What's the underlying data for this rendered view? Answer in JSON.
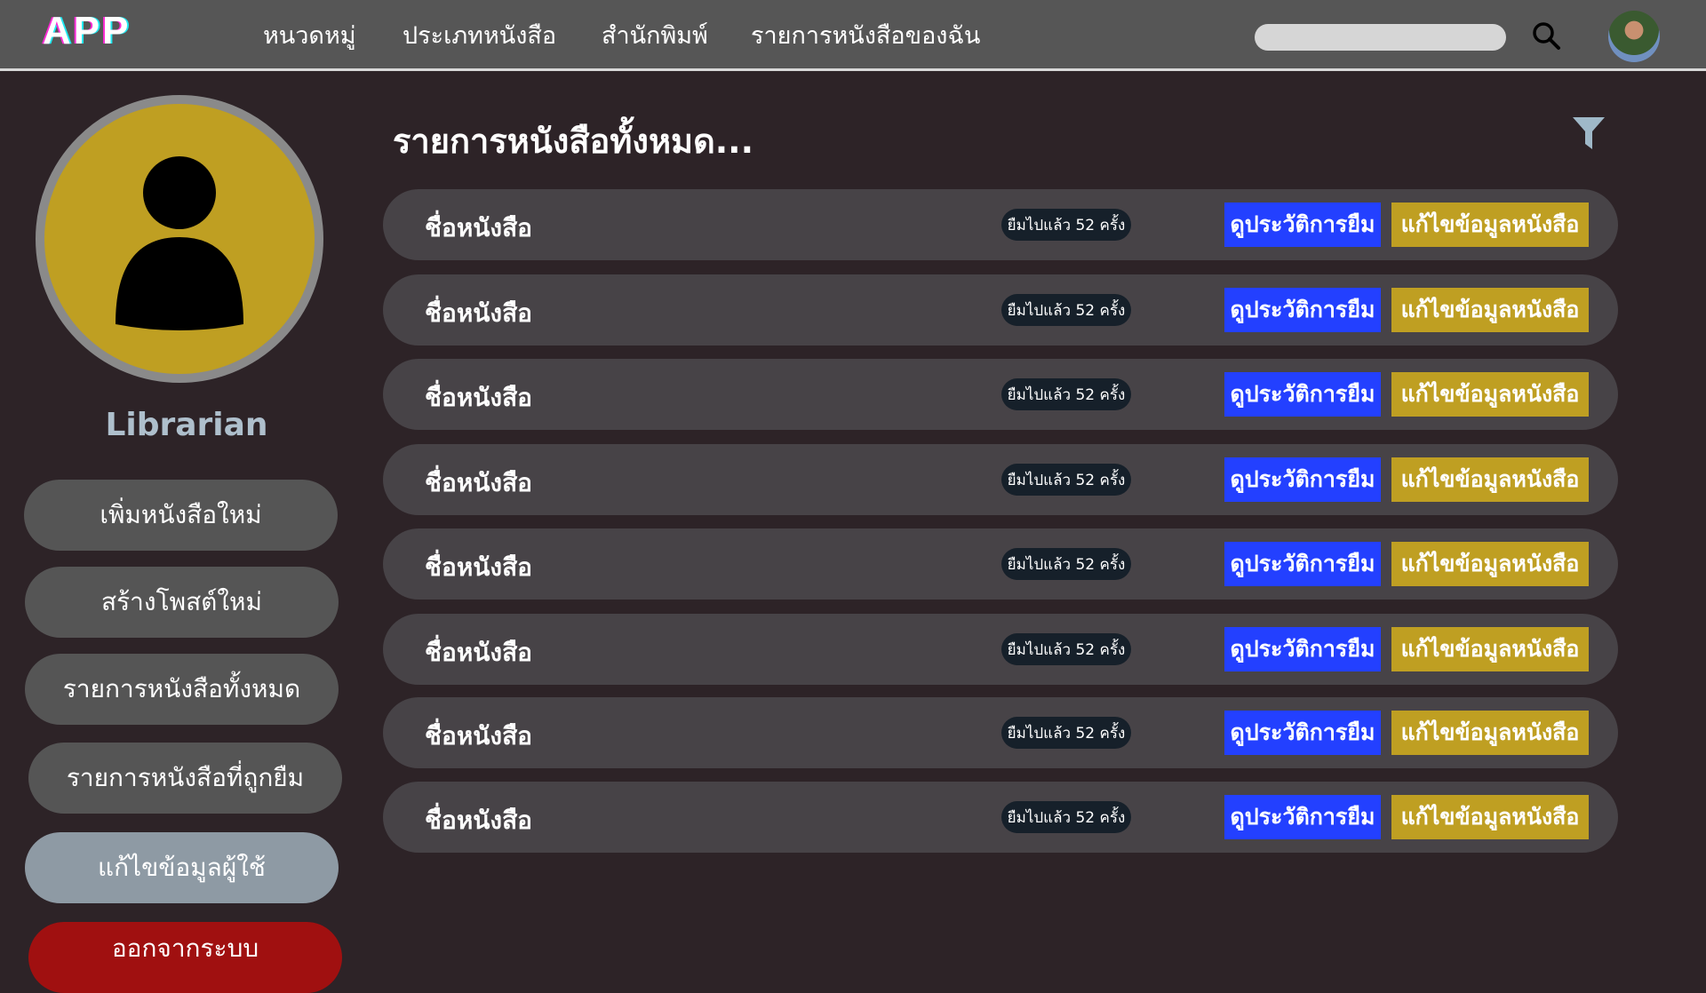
{
  "header": {
    "logo": "APP",
    "nav": [
      "หนวดหมู่",
      "ประเภทหนังสือ",
      "สำนักพิมพ์",
      "รายการหนังสือของฉัน"
    ],
    "search_placeholder": ""
  },
  "sidebar": {
    "role": "Librarian",
    "items": [
      {
        "label": "เพิ่มหนังสือใหม่"
      },
      {
        "label": "สร้างโพสต์ใหม่"
      },
      {
        "label": "รายการหนังสือทั้งหมด"
      },
      {
        "label": "รายการหนังสือที่ถูกยืม"
      },
      {
        "label": "แก้ไขข้อมูลผู้ใช้",
        "active": true
      },
      {
        "label": "ออกจากระบบ"
      }
    ]
  },
  "main": {
    "title": "รายการหนังสือทั้งหมด...",
    "rows": [
      {
        "name": "ชื่อหนังสือ",
        "badge": "ยืมไปแล้ว 52 ครั้ง",
        "history": "ดูประวัติการยืม",
        "edit": "แก้ไขข้อมูลหนังสือ"
      },
      {
        "name": "ชื่อหนังสือ",
        "badge": "ยืมไปแล้ว 52 ครั้ง",
        "history": "ดูประวัติการยืม",
        "edit": "แก้ไขข้อมูลหนังสือ"
      },
      {
        "name": "ชื่อหนังสือ",
        "badge": "ยืมไปแล้ว 52 ครั้ง",
        "history": "ดูประวัติการยืม",
        "edit": "แก้ไขข้อมูลหนังสือ"
      },
      {
        "name": "ชื่อหนังสือ",
        "badge": "ยืมไปแล้ว 52 ครั้ง",
        "history": "ดูประวัติการยืม",
        "edit": "แก้ไขข้อมูลหนังสือ"
      },
      {
        "name": "ชื่อหนังสือ",
        "badge": "ยืมไปแล้ว 52 ครั้ง",
        "history": "ดูประวัติการยืม",
        "edit": "แก้ไขข้อมูลหนังสือ"
      },
      {
        "name": "ชื่อหนังสือ",
        "badge": "ยืมไปแล้ว 52 ครั้ง",
        "history": "ดูประวัติการยืม",
        "edit": "แก้ไขข้อมูลหนังสือ"
      },
      {
        "name": "ชื่อหนังสือ",
        "badge": "ยืมไปแล้ว 52 ครั้ง",
        "history": "ดูประวัติการยืม",
        "edit": "แก้ไขข้อมูลหนังสือ"
      },
      {
        "name": "ชื่อหนังสือ",
        "badge": "ยืมไปแล้ว 52 ครั้ง",
        "history": "ดูประวัติการยืม",
        "edit": "แก้ไขข้อมูลหนังสือ"
      }
    ]
  },
  "colors": {
    "accent_blue": "#2340ff",
    "accent_gold": "#bf9f22",
    "logout_red": "#a01010",
    "active_item": "#8e9aa4"
  }
}
